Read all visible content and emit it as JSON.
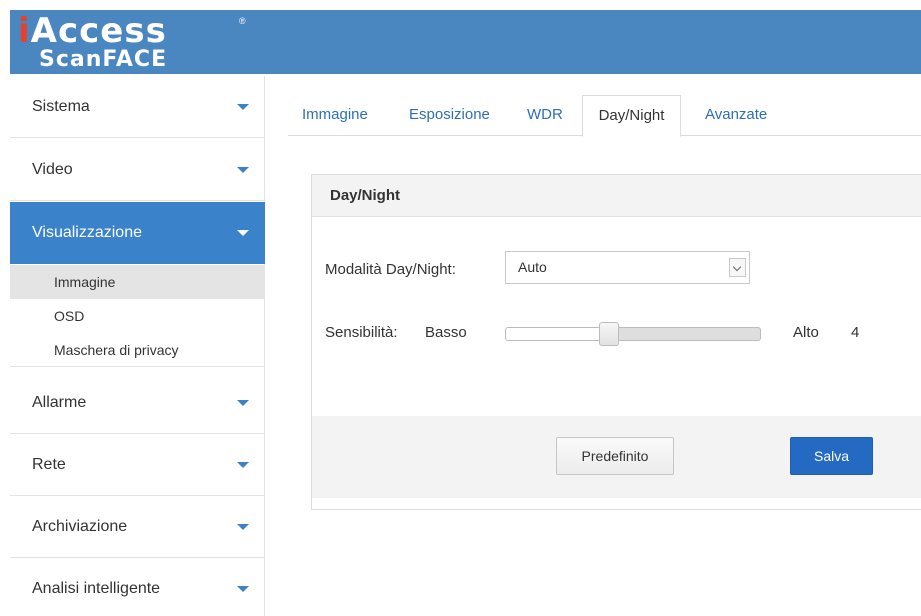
{
  "logo": {
    "line1_first": "i",
    "line1_rest": "Access",
    "registered": "®",
    "line2": "ScanFACE"
  },
  "sidebar": {
    "items": [
      {
        "label": "Sistema"
      },
      {
        "label": "Video"
      },
      {
        "label": "Visualizzazione",
        "active": true
      },
      {
        "label": "Allarme"
      },
      {
        "label": "Rete"
      },
      {
        "label": "Archiviazione"
      },
      {
        "label": "Analisi intelligente"
      }
    ],
    "sub_items": [
      {
        "label": "Immagine",
        "selected": true
      },
      {
        "label": "OSD"
      },
      {
        "label": "Maschera di privacy"
      }
    ]
  },
  "tabs": [
    {
      "label": "Immagine"
    },
    {
      "label": "Esposizione"
    },
    {
      "label": "WDR"
    },
    {
      "label": "Day/Night",
      "active": true
    },
    {
      "label": "Avanzate"
    }
  ],
  "panel": {
    "title": "Day/Night",
    "mode_label": "Modalità Day/Night:",
    "mode_value": "Auto",
    "sensitivity_label": "Sensibilità:",
    "sensitivity_low": "Basso",
    "sensitivity_high": "Alto",
    "sensitivity_value": "4",
    "sensitivity_level_fraction": 0.4
  },
  "buttons": {
    "default_label": "Predefinito",
    "save_label": "Salva"
  },
  "colors": {
    "header": "#4a86bf",
    "accent": "#3a82c9",
    "logo_red": "#e8402a",
    "primary_button": "#2469c2"
  }
}
